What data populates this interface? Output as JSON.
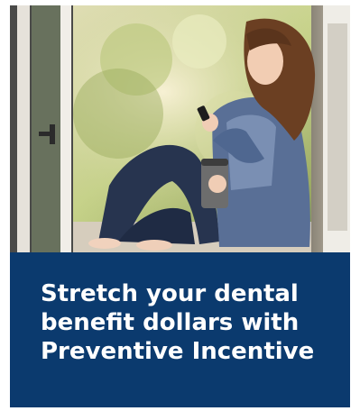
{
  "promo": {
    "headline_lines": [
      "Stretch your dental",
      "benefit dollars with",
      "Preventive Incentive"
    ],
    "banner_color": "#0b3a6e",
    "text_color": "#ffffff"
  },
  "photo": {
    "subject": "woman-seated-in-doorway-with-phone-and-tumbler-image"
  }
}
